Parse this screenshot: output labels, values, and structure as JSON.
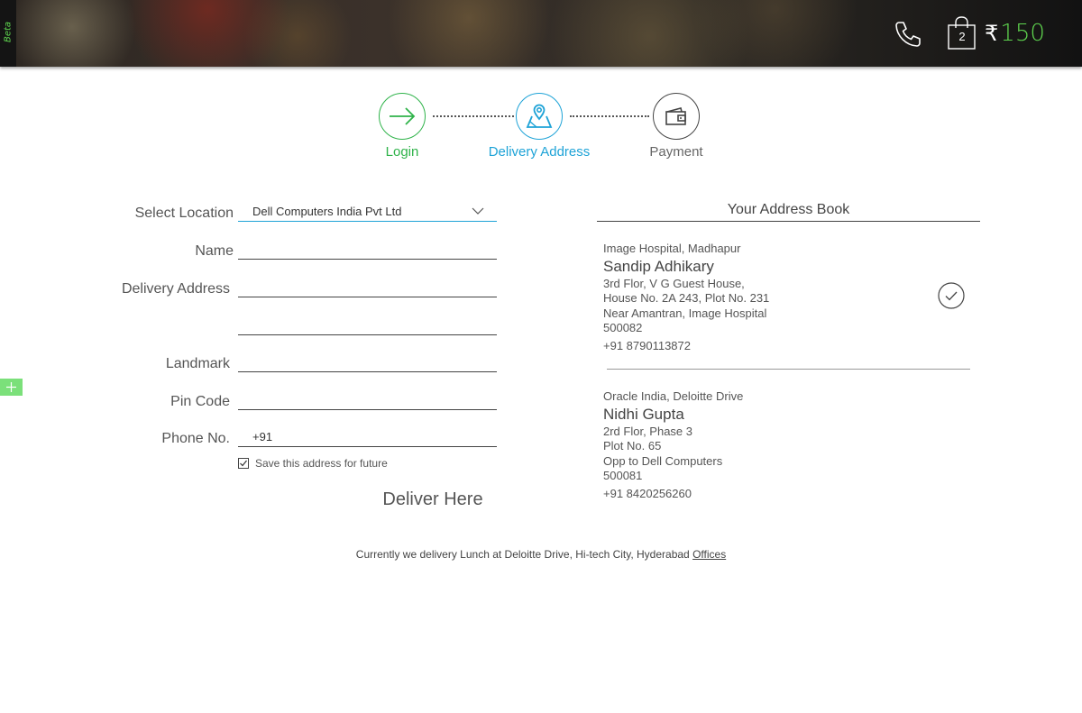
{
  "header": {
    "beta_label": "Beta",
    "phone_icon": "phone-icon",
    "cart_icon": "shopping-bag-icon",
    "cart_count": "2",
    "currency_symbol": "₹",
    "cart_total": "150",
    "accent_color": "#5fd64f"
  },
  "steps": [
    {
      "label": "Login",
      "icon": "arrow-right-icon",
      "state": "done",
      "color": "#2fb34a"
    },
    {
      "label": "Delivery Address",
      "icon": "map-pin-icon",
      "state": "active",
      "color": "#1ea3d7"
    },
    {
      "label": "Payment",
      "icon": "wallet-icon",
      "state": "pending",
      "color": "#444444"
    }
  ],
  "form": {
    "location_label": "Select Location",
    "location_value": "Dell Computers India Pvt Ltd",
    "name_label": "Name",
    "name_value": "",
    "address_label": "Delivery Address",
    "address_line1": "",
    "address_line2": "",
    "landmark_label": "Landmark",
    "landmark_value": "",
    "pincode_label": "Pin Code",
    "pincode_value": "",
    "phone_label": "Phone No.",
    "phone_prefix": "+91",
    "save_label": "Save this address for future",
    "save_checked": true,
    "submit_label": "Deliver Here"
  },
  "address_book": {
    "title": "Your Address Book",
    "addresses": [
      {
        "place": "Image Hospital, Madhapur",
        "name": "Sandip Adhikary",
        "lines": [
          "3rd Flor, V G Guest House,",
          "House No. 2A 243, Plot No. 231",
          "Near Amantran, Image Hospital",
          "500082"
        ],
        "phone": "+91 8790113872",
        "selected": true
      },
      {
        "place": "Oracle India, Deloitte Drive",
        "name": "Nidhi Gupta",
        "lines": [
          "2rd Flor, Phase 3",
          "Plot No. 65",
          "Opp to Dell Computers",
          "500081"
        ],
        "phone": "+91 8420256260",
        "selected": false
      }
    ]
  },
  "footer": {
    "note": "Currently we delivery Lunch at Deloitte Drive, Hi-tech City, Hyderabad ",
    "link": "Offices"
  }
}
